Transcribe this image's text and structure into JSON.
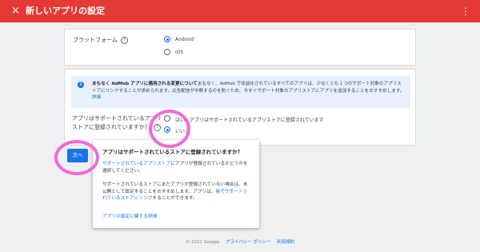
{
  "header": {
    "close_icon": "×",
    "title": "新しいアプリの設定",
    "more_icon": "⋮"
  },
  "platform": {
    "label": "プラットフォーム",
    "help": "?",
    "options": [
      "Android",
      "iOS"
    ],
    "selected": "Android"
  },
  "banner": {
    "bold": "まもなく AdMob アプリに適用される変更について",
    "text": "まもなく、AdMob で収益化されているすべてのアプリは、少なくとも１つのサポート対象のアプリストアにリンクすることが求められます。広告配信が中断するのを防ぐため、今すぐサポート対象のアプリストアにアプリを追加することをおすすめします。",
    "link": "詳細"
  },
  "store": {
    "question": "アプリはサポートされているアプリストアに登録されていますか？",
    "help": "?",
    "options": [
      "はい、アプリはサポートされているアプリストアに登録されています",
      "いいえ"
    ],
    "selected": "いいえ"
  },
  "popup": {
    "title": "アプリはサポートされているストアに登録されていますか？",
    "p1_link": "サポートされているアプリストア",
    "p1_rest": "にアプリが登録されているかどうかを選択してください。",
    "p2_text": "サポートされているストアにまだアプリが登録されていない場合は、未公開として設定することをおすすめします。アプリは、",
    "p2_link": "後でサポートされているストアにリンク",
    "p2_end": "することができます。",
    "link": "アプリの設定に関する詳細"
  },
  "next_button": "次へ",
  "footer": {
    "copyright": "© 2021 Google",
    "privacy": "プライバシー ポリシー",
    "terms": "利用規約"
  },
  "colors": {
    "header": "#e53935",
    "accent": "#1a73e8",
    "highlight_circle": "#f06ad6"
  }
}
